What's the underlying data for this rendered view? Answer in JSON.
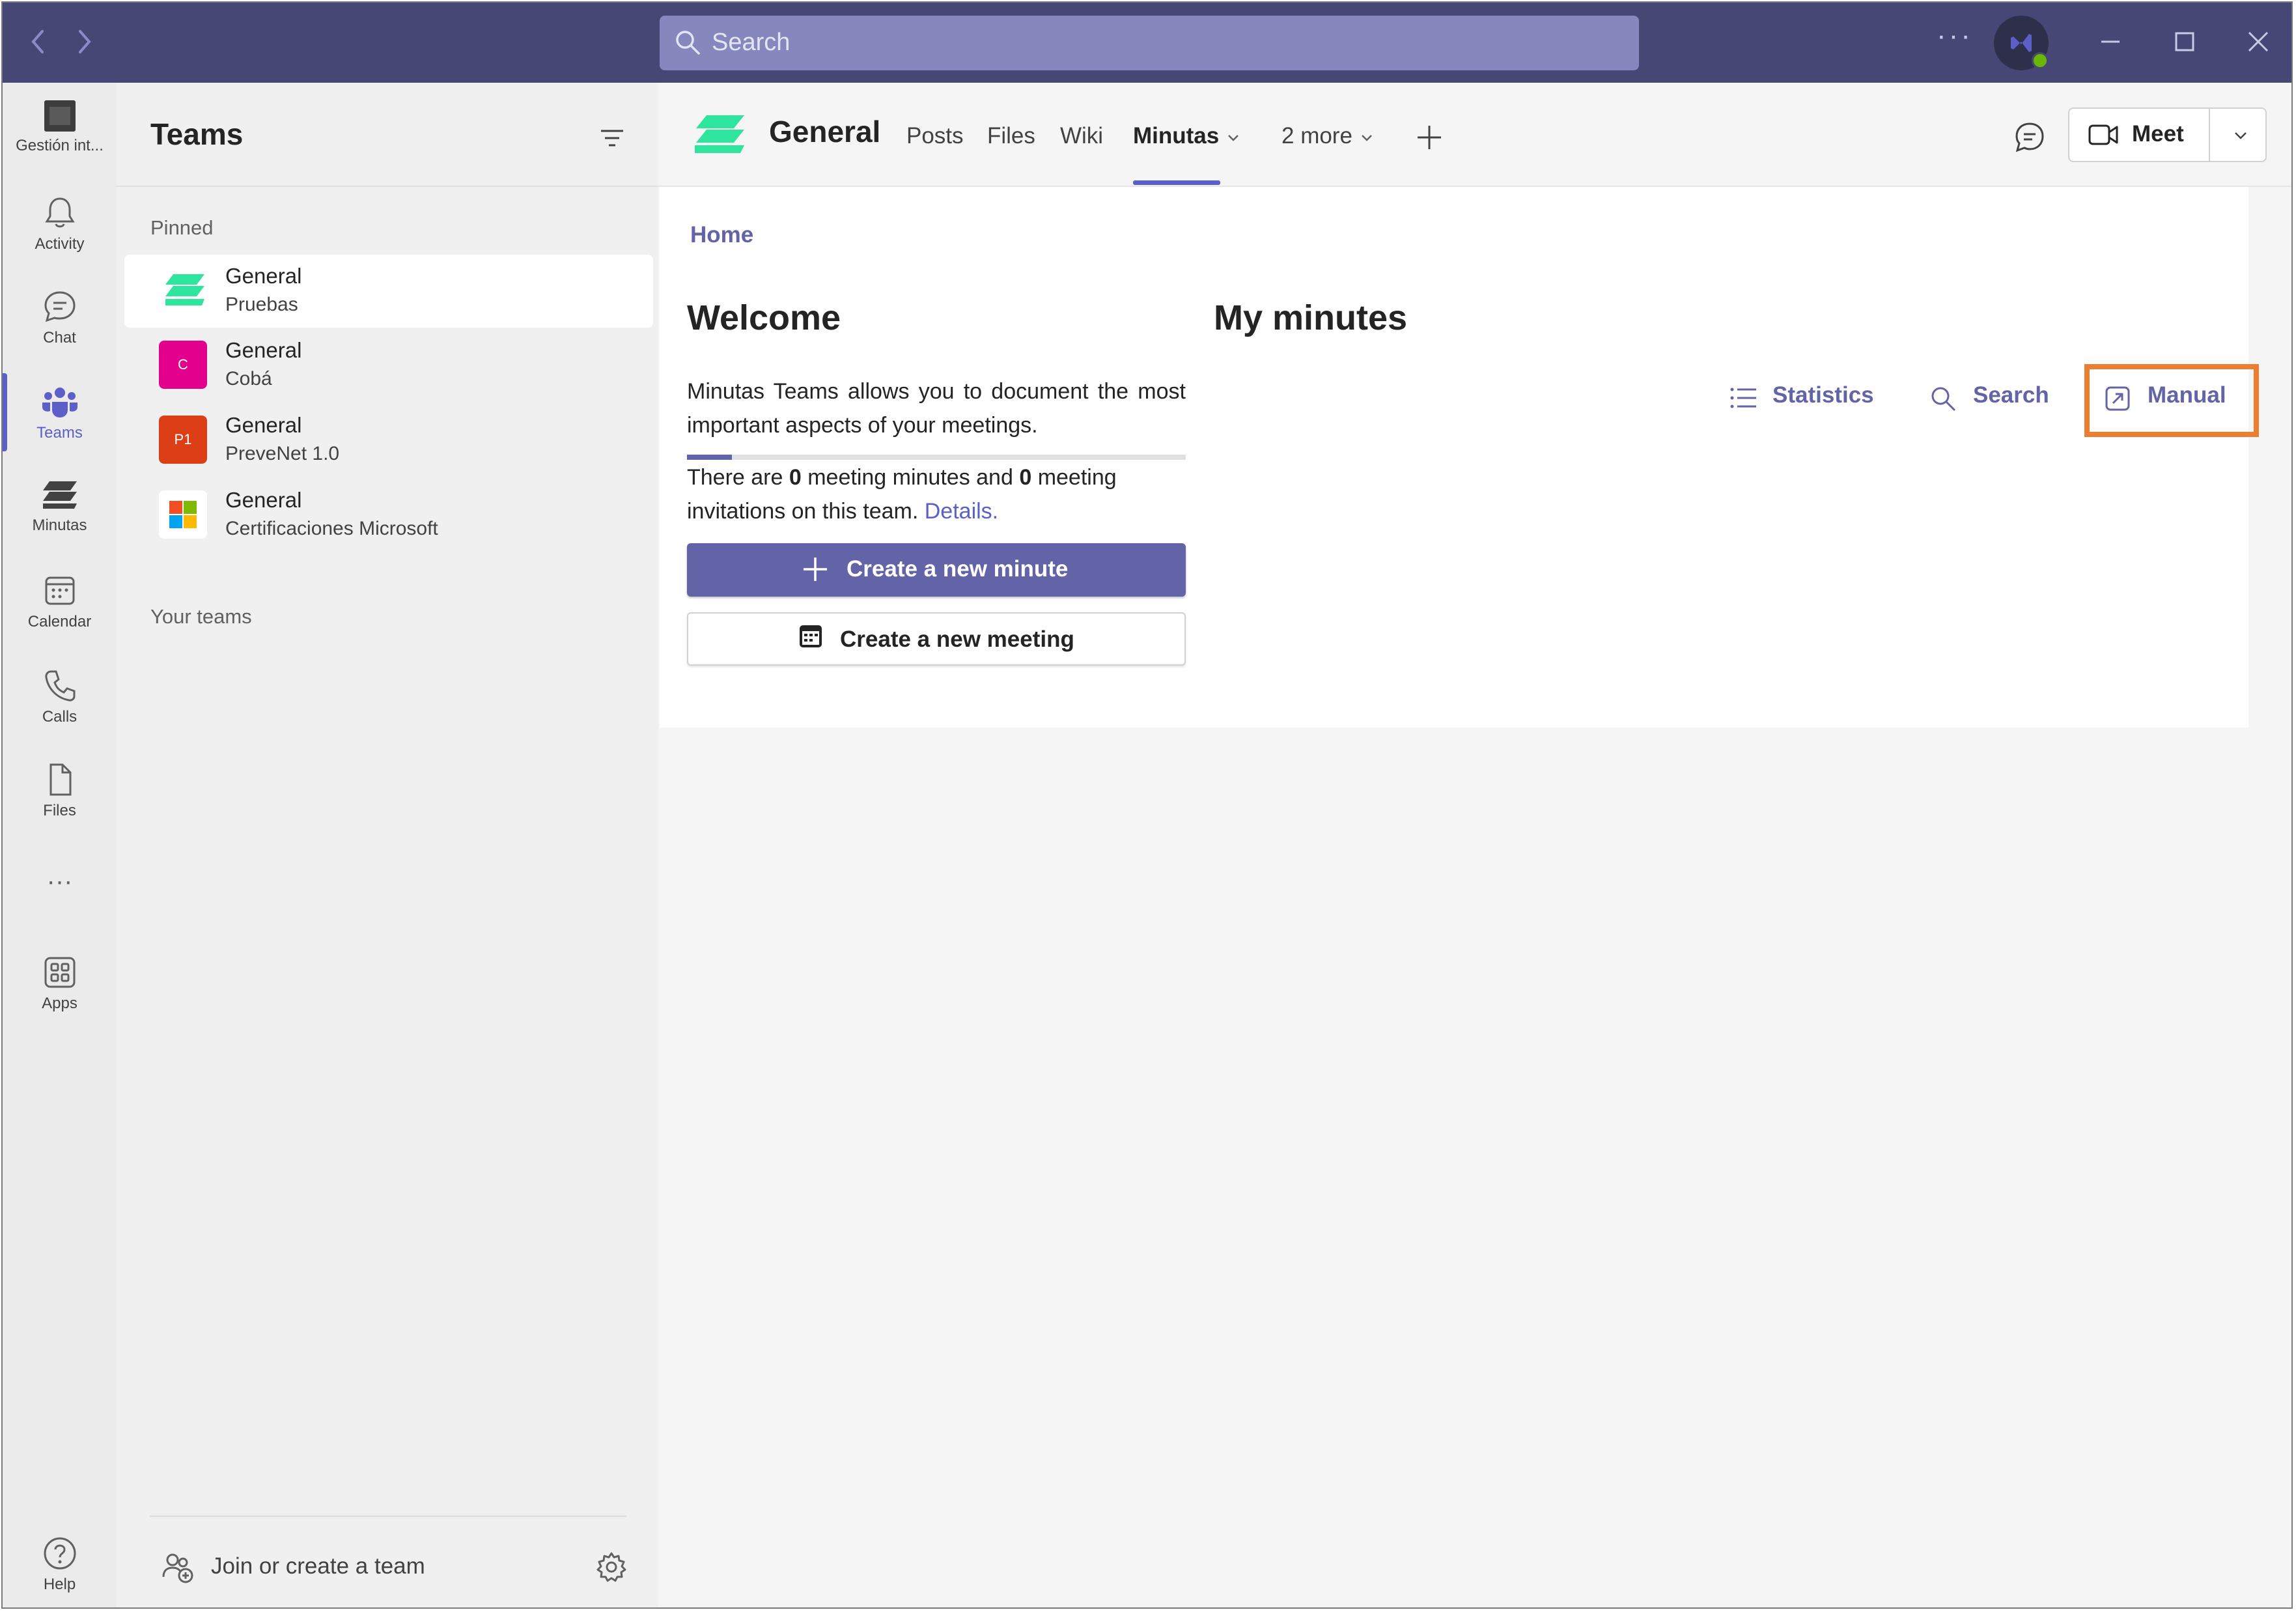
{
  "titlebar": {
    "search_placeholder": "Search",
    "more_label": "···"
  },
  "rail": {
    "items": [
      {
        "label": "Gestión int...",
        "icon": "app-tile-icon"
      },
      {
        "label": "Activity",
        "icon": "bell-icon"
      },
      {
        "label": "Chat",
        "icon": "chat-icon"
      },
      {
        "label": "Teams",
        "icon": "teams-icon",
        "active": true
      },
      {
        "label": "Minutas",
        "icon": "minutas-icon"
      },
      {
        "label": "Calendar",
        "icon": "calendar-icon"
      },
      {
        "label": "Calls",
        "icon": "phone-icon"
      },
      {
        "label": "Files",
        "icon": "file-icon"
      },
      {
        "label": "···",
        "icon": "more-icon"
      },
      {
        "label": "Apps",
        "icon": "apps-icon"
      },
      {
        "label": "Help",
        "icon": "help-icon"
      }
    ]
  },
  "teams_pane": {
    "title": "Teams",
    "pinned_label": "Pinned",
    "your_teams_label": "Your teams",
    "pinned": [
      {
        "name": "General",
        "team": "Pruebas",
        "avatar": "",
        "color": "#ffffff",
        "selected": true
      },
      {
        "name": "General",
        "team": "Cobá",
        "avatar": "C",
        "color": "#e3008c"
      },
      {
        "name": "General",
        "team": "PreveNet 1.0",
        "avatar": "P1",
        "color": "#dc3e15"
      },
      {
        "name": "General",
        "team": "Certificaciones Microsoft",
        "avatar": "",
        "color": "#ffffff"
      }
    ],
    "join_label": "Join or create a team"
  },
  "channel_header": {
    "name": "General",
    "tabs": [
      {
        "label": "Posts"
      },
      {
        "label": "Files"
      },
      {
        "label": "Wiki"
      },
      {
        "label": "Minutas",
        "active": true
      },
      {
        "label": "2 more"
      }
    ],
    "meet_label": "Meet"
  },
  "content": {
    "breadcrumb": "Home",
    "welcome_title": "Welcome",
    "welcome_desc": "Minutas Teams allows you to document the most important aspects of your meetings.",
    "progress_fraction": 0.09,
    "counts_prefix": "There are",
    "minutes_count": "0",
    "counts_middle": "meeting minutes and",
    "invitations_count": "0",
    "counts_suffix": "meeting invitations on this team.",
    "details_link": "Details.",
    "create_minute_label": "Create a new minute",
    "create_meeting_label": "Create a new meeting",
    "my_minutes_title": "My minutes",
    "actions": [
      {
        "label": "Statistics",
        "icon": "list-icon"
      },
      {
        "label": "Search",
        "icon": "search-icon"
      },
      {
        "label": "Manual",
        "icon": "open-external-icon",
        "highlighted": true
      }
    ]
  },
  "colors": {
    "titlebar": "#464775",
    "accent": "#6264a7",
    "highlight": "#ed7d31"
  }
}
